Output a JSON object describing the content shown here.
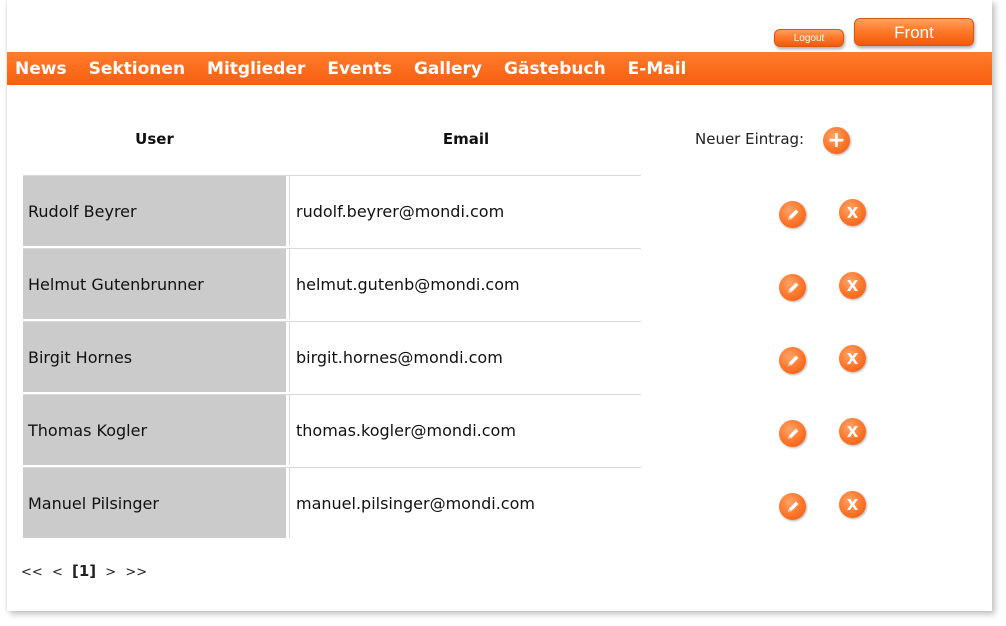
{
  "header": {
    "logout_label": "Logout",
    "front_label": "Front"
  },
  "nav": {
    "items": [
      "News",
      "Sektionen",
      "Mitglieder",
      "Events",
      "Gallery",
      "Gästebuch",
      "E-Mail"
    ]
  },
  "table": {
    "columns": {
      "user": "User",
      "email": "Email"
    },
    "new_entry_label": "Neuer Eintrag:",
    "add_icon": "plus-icon",
    "edit_icon": "pencil-icon",
    "delete_icon": "x-icon",
    "rows": [
      {
        "user": "Rudolf Beyrer",
        "email": "rudolf.beyrer@mondi.com"
      },
      {
        "user": "Helmut Gutenbrunner",
        "email": "helmut.gutenb@mondi.com"
      },
      {
        "user": "Birgit Hornes",
        "email": "birgit.hornes@mondi.com"
      },
      {
        "user": "Thomas Kogler",
        "email": "thomas.kogler@mondi.com"
      },
      {
        "user": "Manuel Pilsinger",
        "email": "manuel.pilsinger@mondi.com"
      }
    ]
  },
  "pager": {
    "first": "<<",
    "prev": "<",
    "current": "[1]",
    "next": ">",
    "last": ">>"
  },
  "colors": {
    "accent": "#ff6a1a",
    "user_cell_bg": "#cbcbcb"
  }
}
